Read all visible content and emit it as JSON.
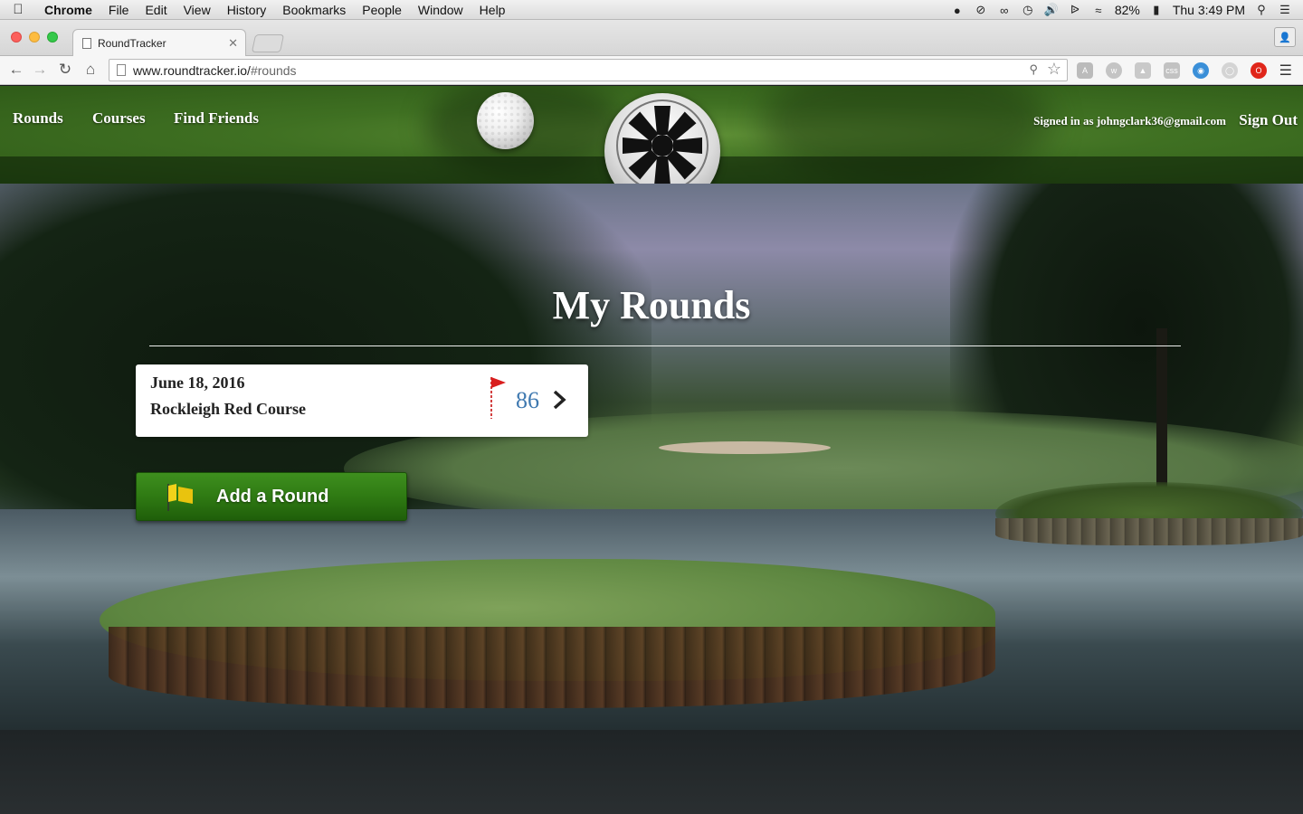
{
  "menubar": {
    "app_name": "Chrome",
    "items": [
      "File",
      "Edit",
      "View",
      "History",
      "Bookmarks",
      "People",
      "Window",
      "Help"
    ],
    "battery": "82%",
    "clock": "Thu 3:49 PM"
  },
  "browser": {
    "tab_title": "RoundTracker",
    "url_host": "www.roundtracker.io/",
    "url_path": "#rounds"
  },
  "header": {
    "nav": [
      "Rounds",
      "Courses",
      "Find Friends"
    ],
    "signed_in": "Signed in as johngclark36@gmail.com",
    "sign_out": "Sign Out"
  },
  "main": {
    "title": "My Rounds",
    "rounds": [
      {
        "date": "June 18, 2016",
        "course": "Rockleigh Red Course",
        "score": "86"
      }
    ],
    "add_button": "Add a Round"
  },
  "colors": {
    "score": "#3f79b0",
    "add_button": "#2f7a13",
    "header_grass": "#3f7022"
  },
  "icons": {
    "round_flag": "red-flag-icon",
    "round_open": "chevron-right-icon",
    "add_round": "yellow-flag-icon",
    "logo": "wheel-logo-icon"
  }
}
